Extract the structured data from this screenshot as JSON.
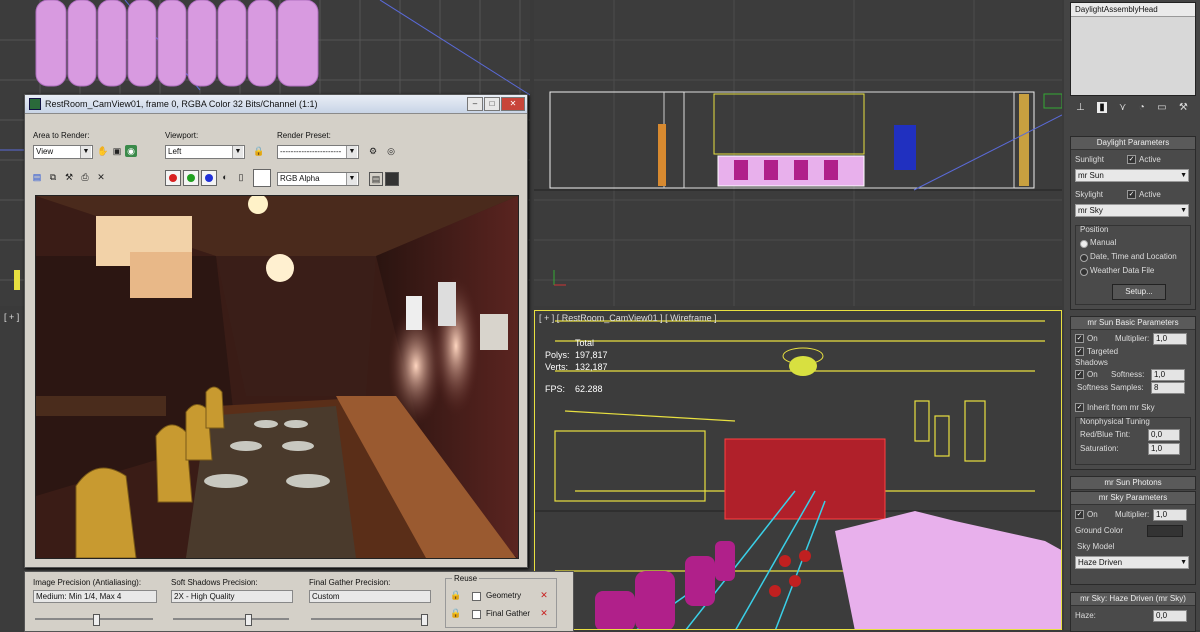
{
  "render_window": {
    "title": "RestRoom_CamView01, frame 0, RGBA Color 32 Bits/Channel (1:1)",
    "area_to_render_label": "Area to Render:",
    "area_to_render_value": "View",
    "viewport_label": "Viewport:",
    "viewport_value": "Left",
    "render_preset_label": "Render Preset:",
    "render_preset_value": "-----------------------",
    "channel_value": "RGB Alpha"
  },
  "mr_panel": {
    "image_precision_label": "Image Precision (Antialiasing):",
    "image_precision_value": "Medium: Min 1/4, Max 4",
    "soft_shadows_label": "Soft Shadows Precision:",
    "soft_shadows_value": "2X - High Quality",
    "final_gather_label": "Final Gather Precision:",
    "final_gather_value": "Custom",
    "reuse_label": "Reuse",
    "geometry_label": "Geometry",
    "final_gather_reuse_label": "Final Gather"
  },
  "viewport_persp": {
    "label": "[ + ] [ RestRoom_CamView01 ] [ Wireframe ]",
    "stats_total": "Total",
    "stats_polys_label": "Polys:",
    "stats_polys_value": "197,817",
    "stats_verts_label": "Verts:",
    "stats_verts_value": "132,187",
    "fps_label": "FPS:",
    "fps_value": "62.288"
  },
  "viewport_left": {
    "label": "[ + ]"
  },
  "command_panel": {
    "object_name": "DaylightAssemblyHead",
    "daylight_params_title": "Daylight Parameters",
    "sunlight_label": "Sunlight",
    "sunlight_active": "Active",
    "sunlight_value": "mr Sun",
    "skylight_label": "Skylight",
    "skylight_active": "Active",
    "skylight_value": "mr Sky",
    "position_label": "Position",
    "pos_manual": "Manual",
    "pos_date": "Date, Time and Location",
    "pos_weather": "Weather Data File",
    "setup_button": "Setup...",
    "sun_basic_title": "mr Sun Basic Parameters",
    "on_label": "On",
    "multiplier_label": "Multiplier:",
    "multiplier_value": "1,0",
    "targeted_label": "Targeted",
    "shadows_label": "Shadows",
    "shadows_on": "On",
    "softness_label": "Softness:",
    "softness_value": "1,0",
    "softness_samples_label": "Softness Samples:",
    "softness_samples_value": "8",
    "inherit_label": "Inherit from mr Sky",
    "nonphys_label": "Nonphysical Tuning",
    "redblue_label": "Red/Blue Tint:",
    "redblue_value": "0,0",
    "saturation_label": "Saturation:",
    "saturation_value": "1,0",
    "sun_photons_title": "mr Sun Photons",
    "sky_params_title": "mr Sky Parameters",
    "sky_on_label": "On",
    "sky_multiplier_label": "Multiplier:",
    "sky_multiplier_value": "1,0",
    "ground_color_label": "Ground Color",
    "sky_model_label": "Sky Model",
    "sky_model_value": "Haze Driven",
    "haze_title": "mr Sky: Haze Driven (mr Sky)",
    "haze_label": "Haze:",
    "haze_value": "0,0"
  },
  "colors": {
    "viewport_bg": "#3c3c3c",
    "ui_gray": "#d4d0c8",
    "wire_yellow": "#e8e040",
    "wire_pink": "#e0a0e8",
    "wire_cyan": "#3ad0e8",
    "wire_magenta": "#b0208a"
  }
}
